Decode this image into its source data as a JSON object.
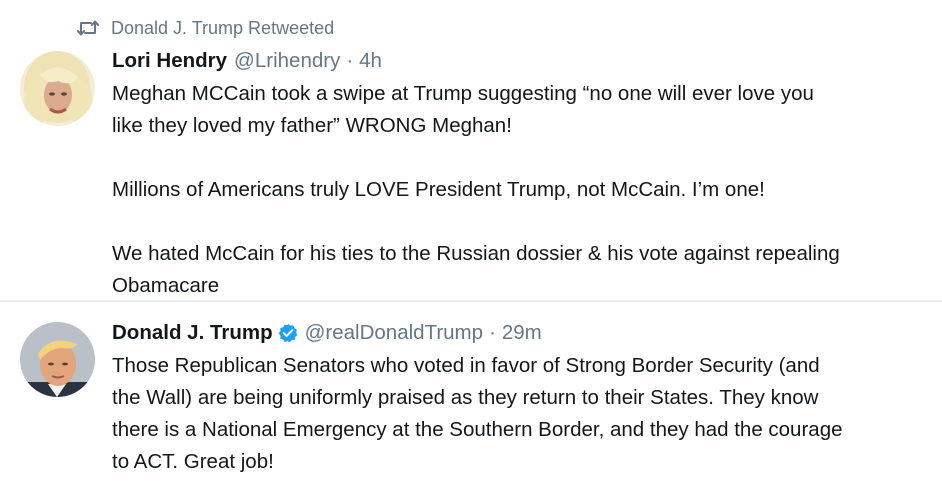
{
  "retweet_context": {
    "text": "Donald J. Trump Retweeted",
    "icon": "retweet-icon"
  },
  "tweets": [
    {
      "fullname": "Lori Hendry",
      "username": "@Lrihendry",
      "separator": "·",
      "timestamp": "4h",
      "verified": false,
      "paragraphs": [
        [
          "Meghan MCCain took a swipe at Trump suggesting “no one will ever love you",
          "like they loved my father” WRONG Meghan!"
        ],
        [
          "Millions of Americans truly LOVE President Trump, not McCain. I’m one!"
        ],
        [
          "We hated McCain for his ties to the Russian dossier & his vote against repealing",
          "Obamacare"
        ]
      ]
    },
    {
      "fullname": "Donald J. Trump",
      "username": "@realDonaldTrump",
      "separator": "·",
      "timestamp": "29m",
      "verified": true,
      "paragraphs": [
        [
          "Those Republican Senators who voted in favor of Strong Border Security (and",
          "the Wall) are being uniformly praised as they return to their States. They know",
          "there is a National Emergency at the Southern Border, and they had the courage",
          "to ACT. Great job!"
        ]
      ]
    }
  ],
  "colors": {
    "text": "#14171a",
    "muted": "#657786",
    "verified": "#1da1f2",
    "divider": "#e6ecf0"
  }
}
